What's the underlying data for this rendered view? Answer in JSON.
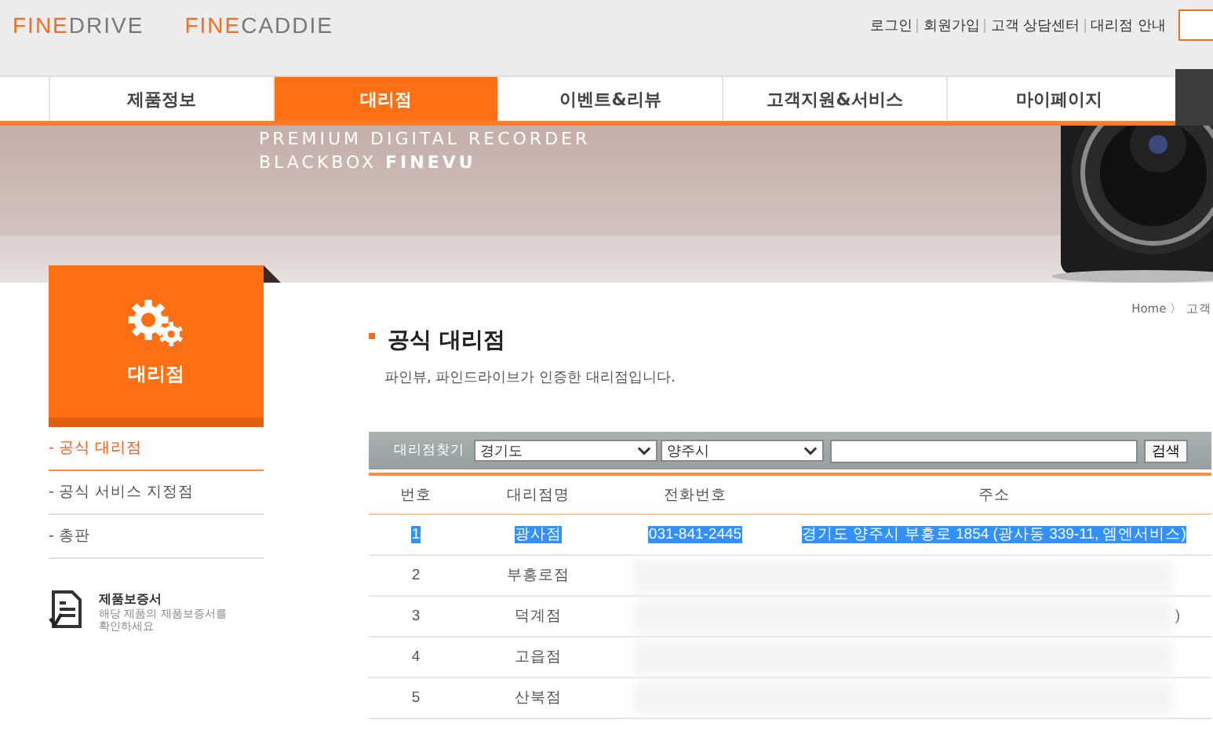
{
  "header": {
    "logos": [
      {
        "bold": "FINE",
        "light": "DRIVE"
      },
      {
        "bold": "FINE",
        "light": "CADDIE"
      }
    ],
    "links": [
      "로그인",
      "회원가입",
      "고객 상담센터",
      "대리점 안내"
    ]
  },
  "nav": [
    {
      "label": "제품정보",
      "selected": false
    },
    {
      "label": "대리점",
      "selected": true
    },
    {
      "label": "이벤트&리뷰",
      "selected": false
    },
    {
      "label": "고객지원&서비스",
      "selected": false
    },
    {
      "label": "마이페이지",
      "selected": false
    }
  ],
  "banner": {
    "line1": "PREMIUM DIGITAL RECORDER",
    "line2_prefix": "BLACKBOX ",
    "line2_brand": "FINEVU"
  },
  "sidebar": {
    "title": "대리점",
    "items": [
      {
        "label": "- 공식 대리점",
        "selected": true
      },
      {
        "label": "- 공식 서비스 지정점",
        "selected": false
      },
      {
        "label": "- 총판",
        "selected": false
      }
    ],
    "warranty": {
      "title": "제품보증서",
      "text": "해당 제품의 제품보증서를 확인하세요"
    }
  },
  "breadcrumb": "Home 〉 고객",
  "page": {
    "title": "공식 대리점",
    "subtitle": "파인뷰, 파인드라이브가 인증한 대리점입니다."
  },
  "search": {
    "label": "대리점찾기",
    "province": "경기도",
    "city": "양주시",
    "button": "검색"
  },
  "table": {
    "columns": [
      "번호",
      "대리점명",
      "전화번호",
      "주소"
    ],
    "rows": [
      {
        "no": "1",
        "name": "광사점",
        "phone": "031-841-2445",
        "address": "경기도 양주시 부흥로 1854 (광사동 339-11, 엠엔서비스)",
        "selected": true,
        "redacted": false
      },
      {
        "no": "2",
        "name": "부흥로점",
        "selected": false,
        "redacted": true
      },
      {
        "no": "3",
        "name": "덕계점",
        "address": ")",
        "selected": false,
        "redacted": true
      },
      {
        "no": "4",
        "name": "고읍점",
        "selected": false,
        "redacted": true
      },
      {
        "no": "5",
        "name": "산북점",
        "selected": false,
        "redacted": true
      }
    ]
  }
}
